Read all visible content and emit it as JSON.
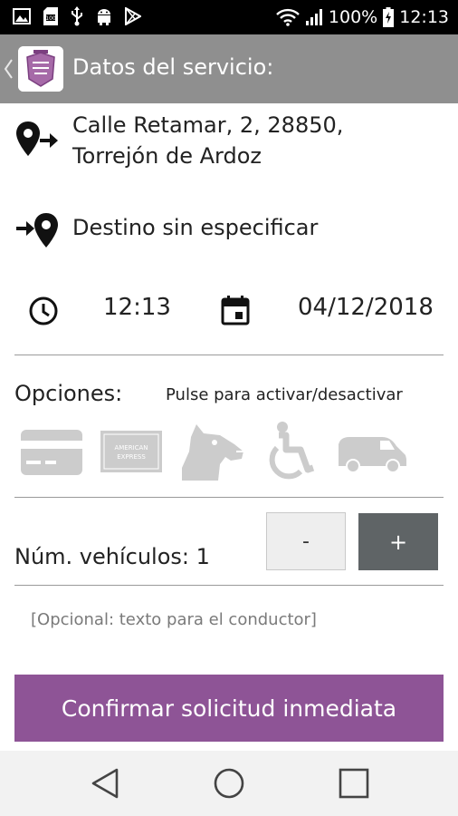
{
  "status_bar": {
    "battery": "100%",
    "time": "12:13",
    "icons": [
      "image-icon",
      "sd-card-icon",
      "usb-icon",
      "android-icon",
      "play-store-icon",
      "wifi-icon",
      "signal-icon",
      "battery-icon"
    ]
  },
  "app_bar": {
    "title": "Datos del servicio:",
    "icons": [
      "back-chevron-icon",
      "app-logo"
    ]
  },
  "route": {
    "origin": "Calle Retamar, 2, 28850, Torrejón de Ardoz",
    "destination": "Destino sin especificar"
  },
  "schedule": {
    "time": "12:13",
    "date": "04/12/2018"
  },
  "options": {
    "label": "Opciones:",
    "hint": "Pulse para activar/desactivar",
    "items": [
      {
        "name": "credit-card",
        "icon": "credit-card-icon"
      },
      {
        "name": "american-express",
        "icon": "amex-card-icon",
        "card_text": "AMERICAN EXPRESS"
      },
      {
        "name": "pet",
        "icon": "dog-icon"
      },
      {
        "name": "accessible",
        "icon": "wheelchair-icon"
      },
      {
        "name": "van",
        "icon": "van-icon"
      }
    ],
    "inactive_color": "#cccccc"
  },
  "vehicles": {
    "label": "Núm. vehículos: 1",
    "minus_label": "-",
    "plus_label": "+"
  },
  "note": {
    "placeholder": "[Opcional: texto para el conductor]",
    "value": ""
  },
  "confirm": {
    "label": "Confirmar solicitud inmediata"
  },
  "colors": {
    "accent": "#8e5496",
    "app_bar": "#8f8f8f",
    "plus_button": "#5f6466"
  },
  "nav_bar": {
    "icons": [
      "back-triangle-icon",
      "home-circle-icon",
      "recents-square-icon"
    ]
  }
}
